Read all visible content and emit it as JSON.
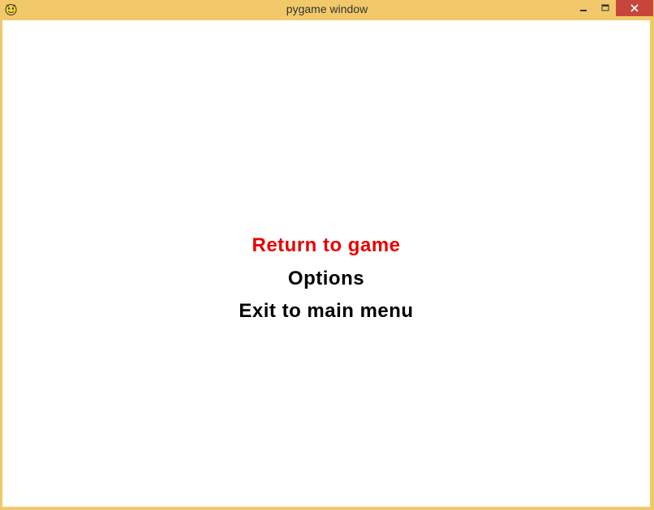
{
  "window": {
    "title": "pygame window",
    "frame_color": "#f1c96a",
    "close_button_color": "#c7463b"
  },
  "icons": {
    "app": "pygame-snake-icon",
    "minimize": "minimize-icon",
    "maximize": "maximize-icon",
    "close": "close-icon"
  },
  "menu": {
    "items": [
      {
        "label": "Return to game",
        "color": "#e80000",
        "selected": true
      },
      {
        "label": "Options",
        "color": "#000000",
        "selected": false
      },
      {
        "label": "Exit to main menu",
        "color": "#000000",
        "selected": false
      }
    ]
  }
}
